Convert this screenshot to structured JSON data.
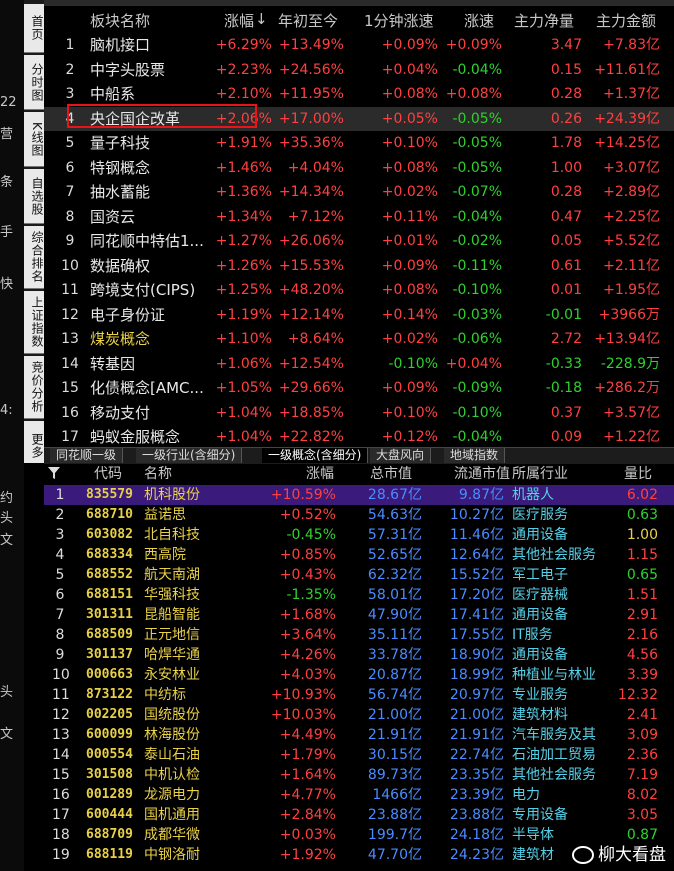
{
  "left_strip": [
    "22",
    "营",
    "条",
    "手",
    "快",
    "4:",
    "约",
    "头",
    "文",
    "头",
    "文"
  ],
  "nav_tabs": [
    "首页",
    "分时图",
    "K线图",
    "自选股",
    "综合排名",
    "上证指数",
    "竞价分析",
    "更多"
  ],
  "top_headers": [
    "板块名称",
    "涨幅",
    "年初至今",
    "1分钟涨速",
    "涨速",
    "主力净量",
    "主力金额"
  ],
  "top_rows": [
    {
      "n": "1",
      "name": "脑机接口",
      "chg": "+6.29%",
      "ytd": "+13.49%",
      "m1": "+0.09%",
      "spd": "+0.09%",
      "net": "3.47",
      "amt": "+7.83亿",
      "cm1": "r",
      "cspd": "r",
      "cnet": "r",
      "camt": "r"
    },
    {
      "n": "2",
      "name": "中字头股票",
      "chg": "+2.23%",
      "ytd": "+24.56%",
      "m1": "+0.04%",
      "spd": "-0.04%",
      "net": "0.15",
      "amt": "+11.61亿",
      "cm1": "r",
      "cspd": "g",
      "cnet": "r",
      "camt": "r"
    },
    {
      "n": "3",
      "name": "中船系",
      "chg": "+2.10%",
      "ytd": "+11.95%",
      "m1": "+0.08%",
      "spd": "+0.08%",
      "net": "0.28",
      "amt": "+1.37亿",
      "cm1": "r",
      "cspd": "r",
      "cnet": "r",
      "camt": "r"
    },
    {
      "n": "4",
      "name": "央企国企改革",
      "chg": "+2.06%",
      "ytd": "+17.00%",
      "m1": "+0.05%",
      "spd": "-0.05%",
      "net": "0.26",
      "amt": "+24.39亿",
      "cm1": "r",
      "cspd": "g",
      "cnet": "r",
      "camt": "r"
    },
    {
      "n": "5",
      "name": "量子科技",
      "chg": "+1.91%",
      "ytd": "+35.36%",
      "m1": "+0.10%",
      "spd": "-0.05%",
      "net": "1.78",
      "amt": "+14.25亿",
      "cm1": "r",
      "cspd": "g",
      "cnet": "r",
      "camt": "r"
    },
    {
      "n": "6",
      "name": "特钢概念",
      "chg": "+1.46%",
      "ytd": "+4.04%",
      "m1": "+0.08%",
      "spd": "-0.05%",
      "net": "1.00",
      "amt": "+3.07亿",
      "cm1": "r",
      "cspd": "g",
      "cnet": "r",
      "camt": "r"
    },
    {
      "n": "7",
      "name": "抽水蓄能",
      "chg": "+1.36%",
      "ytd": "+14.34%",
      "m1": "+0.02%",
      "spd": "-0.07%",
      "net": "0.28",
      "amt": "+2.89亿",
      "cm1": "r",
      "cspd": "g",
      "cnet": "r",
      "camt": "r"
    },
    {
      "n": "8",
      "name": "国资云",
      "chg": "+1.34%",
      "ytd": "+7.12%",
      "m1": "+0.11%",
      "spd": "-0.04%",
      "net": "0.47",
      "amt": "+2.25亿",
      "cm1": "r",
      "cspd": "g",
      "cnet": "r",
      "camt": "r"
    },
    {
      "n": "9",
      "name": "同花顺中特估1...",
      "chg": "+1.27%",
      "ytd": "+26.06%",
      "m1": "+0.01%",
      "spd": "-0.02%",
      "net": "0.05",
      "amt": "+5.52亿",
      "cm1": "r",
      "cspd": "g",
      "cnet": "r",
      "camt": "r"
    },
    {
      "n": "10",
      "name": "数据确权",
      "chg": "+1.26%",
      "ytd": "+15.53%",
      "m1": "+0.09%",
      "spd": "-0.11%",
      "net": "0.61",
      "amt": "+2.11亿",
      "cm1": "r",
      "cspd": "g",
      "cnet": "r",
      "camt": "r"
    },
    {
      "n": "11",
      "name": "跨境支付(CIPS)",
      "chg": "+1.25%",
      "ytd": "+48.20%",
      "m1": "+0.08%",
      "spd": "-0.10%",
      "net": "0.01",
      "amt": "+1.95亿",
      "cm1": "r",
      "cspd": "g",
      "cnet": "r",
      "camt": "r"
    },
    {
      "n": "12",
      "name": "电子身份证",
      "chg": "+1.19%",
      "ytd": "+12.14%",
      "m1": "+0.14%",
      "spd": "-0.03%",
      "net": "-0.01",
      "amt": "+3966万",
      "cm1": "r",
      "cspd": "g",
      "cnet": "g",
      "camt": "r"
    },
    {
      "n": "13",
      "name": "煤炭概念",
      "chg": "+1.10%",
      "ytd": "+8.64%",
      "m1": "+0.02%",
      "spd": "-0.06%",
      "net": "2.72",
      "amt": "+13.94亿",
      "cm1": "r",
      "cspd": "g",
      "cnet": "r",
      "camt": "r",
      "nameColor": "y"
    },
    {
      "n": "14",
      "name": "转基因",
      "chg": "+1.06%",
      "ytd": "+12.54%",
      "m1": "-0.10%",
      "spd": "+0.04%",
      "net": "-0.33",
      "amt": "-228.9万",
      "cm1": "g",
      "cspd": "r",
      "cnet": "g",
      "camt": "g"
    },
    {
      "n": "15",
      "name": "化债概念[AMC...",
      "chg": "+1.05%",
      "ytd": "+29.66%",
      "m1": "+0.09%",
      "spd": "-0.09%",
      "net": "-0.18",
      "amt": "+286.2万",
      "cm1": "r",
      "cspd": "g",
      "cnet": "g",
      "camt": "r"
    },
    {
      "n": "16",
      "name": "移动支付",
      "chg": "+1.04%",
      "ytd": "+18.85%",
      "m1": "+0.10%",
      "spd": "-0.10%",
      "net": "0.37",
      "amt": "+3.57亿",
      "cm1": "r",
      "cspd": "g",
      "cnet": "r",
      "camt": "r"
    },
    {
      "n": "17",
      "name": "蚂蚁金服概念",
      "chg": "+1.04%",
      "ytd": "+22.82%",
      "m1": "+0.12%",
      "spd": "-0.04%",
      "net": "0.09",
      "amt": "+1.22亿",
      "cm1": "r",
      "cspd": "g",
      "cnet": "r",
      "camt": "r"
    }
  ],
  "tabs": [
    "同花顺一级",
    "一级行业(含细分)",
    "一级概念(含细分)",
    "大盘风向",
    "地域指数"
  ],
  "bottom_headers": [
    "代码",
    "名称",
    "涨幅",
    "总市值",
    "流通市值",
    "所属行业",
    "量比"
  ],
  "bottom_rows": [
    {
      "n": "1",
      "code": "835579",
      "name": "机科股份",
      "chg": "+10.59%",
      "mcap": "28.67亿",
      "fcap": "9.87亿",
      "ind": "机器人",
      "vr": "6.02",
      "cc": "r",
      "cv": "r"
    },
    {
      "n": "2",
      "code": "688710",
      "name": "益诺思",
      "chg": "+0.52%",
      "mcap": "54.63亿",
      "fcap": "10.27亿",
      "ind": "医疗服务",
      "vr": "0.63",
      "cc": "r",
      "cv": "g"
    },
    {
      "n": "3",
      "code": "603082",
      "name": "北自科技",
      "chg": "-0.45%",
      "mcap": "57.31亿",
      "fcap": "11.46亿",
      "ind": "通用设备",
      "vr": "1.00",
      "cc": "g",
      "cv": "ylw"
    },
    {
      "n": "4",
      "code": "688334",
      "name": "西高院",
      "chg": "+0.85%",
      "mcap": "52.65亿",
      "fcap": "12.64亿",
      "ind": "其他社会服务",
      "vr": "1.15",
      "cc": "r",
      "cv": "r"
    },
    {
      "n": "5",
      "code": "688552",
      "name": "航天南湖",
      "chg": "+0.43%",
      "mcap": "62.32亿",
      "fcap": "15.52亿",
      "ind": "军工电子",
      "vr": "0.65",
      "cc": "r",
      "cv": "g"
    },
    {
      "n": "6",
      "code": "688151",
      "name": "华强科技",
      "chg": "-1.35%",
      "mcap": "58.01亿",
      "fcap": "17.20亿",
      "ind": "医疗器械",
      "vr": "1.51",
      "cc": "g",
      "cv": "r"
    },
    {
      "n": "7",
      "code": "301311",
      "name": "昆船智能",
      "chg": "+1.68%",
      "mcap": "47.90亿",
      "fcap": "17.41亿",
      "ind": "通用设备",
      "vr": "2.91",
      "cc": "r",
      "cv": "r"
    },
    {
      "n": "8",
      "code": "688509",
      "name": "正元地信",
      "chg": "+3.64%",
      "mcap": "35.11亿",
      "fcap": "17.55亿",
      "ind": "IT服务",
      "vr": "2.16",
      "cc": "r",
      "cv": "r"
    },
    {
      "n": "9",
      "code": "301137",
      "name": "哈焊华通",
      "chg": "+4.26%",
      "mcap": "33.78亿",
      "fcap": "18.90亿",
      "ind": "通用设备",
      "vr": "4.56",
      "cc": "r",
      "cv": "r"
    },
    {
      "n": "10",
      "code": "000663",
      "name": "永安林业",
      "chg": "+4.03%",
      "mcap": "20.87亿",
      "fcap": "18.99亿",
      "ind": "种植业与林业",
      "vr": "3.39",
      "cc": "r",
      "cv": "r"
    },
    {
      "n": "11",
      "code": "873122",
      "name": "中纺标",
      "chg": "+10.93%",
      "mcap": "56.74亿",
      "fcap": "20.97亿",
      "ind": "专业服务",
      "vr": "12.32",
      "cc": "r",
      "cv": "r"
    },
    {
      "n": "12",
      "code": "002205",
      "name": "国统股份",
      "chg": "+10.03%",
      "mcap": "21.00亿",
      "fcap": "21.00亿",
      "ind": "建筑材料",
      "vr": "2.41",
      "cc": "r",
      "cv": "r"
    },
    {
      "n": "13",
      "code": "600099",
      "name": "林海股份",
      "chg": "+4.49%",
      "mcap": "21.91亿",
      "fcap": "21.91亿",
      "ind": "汽车服务及其",
      "vr": "3.09",
      "cc": "r",
      "cv": "r"
    },
    {
      "n": "14",
      "code": "000554",
      "name": "泰山石油",
      "chg": "+1.79%",
      "mcap": "30.15亿",
      "fcap": "22.74亿",
      "ind": "石油加工贸易",
      "vr": "2.36",
      "cc": "r",
      "cv": "r"
    },
    {
      "n": "15",
      "code": "301508",
      "name": "中机认检",
      "chg": "+1.64%",
      "mcap": "89.73亿",
      "fcap": "23.35亿",
      "ind": "其他社会服务",
      "vr": "7.19",
      "cc": "r",
      "cv": "r"
    },
    {
      "n": "16",
      "code": "001289",
      "name": "龙源电力",
      "chg": "+4.77%",
      "mcap": "1466亿",
      "fcap": "23.39亿",
      "ind": "电力",
      "vr": "8.02",
      "cc": "r",
      "cv": "r"
    },
    {
      "n": "17",
      "code": "600444",
      "name": "国机通用",
      "chg": "+2.84%",
      "mcap": "23.88亿",
      "fcap": "23.88亿",
      "ind": "专用设备",
      "vr": "3.05",
      "cc": "r",
      "cv": "r"
    },
    {
      "n": "18",
      "code": "688709",
      "name": "成都华微",
      "chg": "+0.03%",
      "mcap": "199.7亿",
      "fcap": "24.18亿",
      "ind": "半导体",
      "vr": "0.87",
      "cc": "r",
      "cv": "g"
    },
    {
      "n": "19",
      "code": "688119",
      "name": "中钢洛耐",
      "chg": "+1.92%",
      "mcap": "47.70亿",
      "fcap": "24.23亿",
      "ind": "建筑材",
      "vr": "",
      "cc": "r",
      "cv": "r"
    }
  ],
  "watermark": "柳大看盘",
  "colors": {
    "red": "#ff4040",
    "green": "#2fd12f",
    "yellow": "#e8d048",
    "highlight": "#e8141a",
    "selected_row": "#3a1a7a"
  }
}
